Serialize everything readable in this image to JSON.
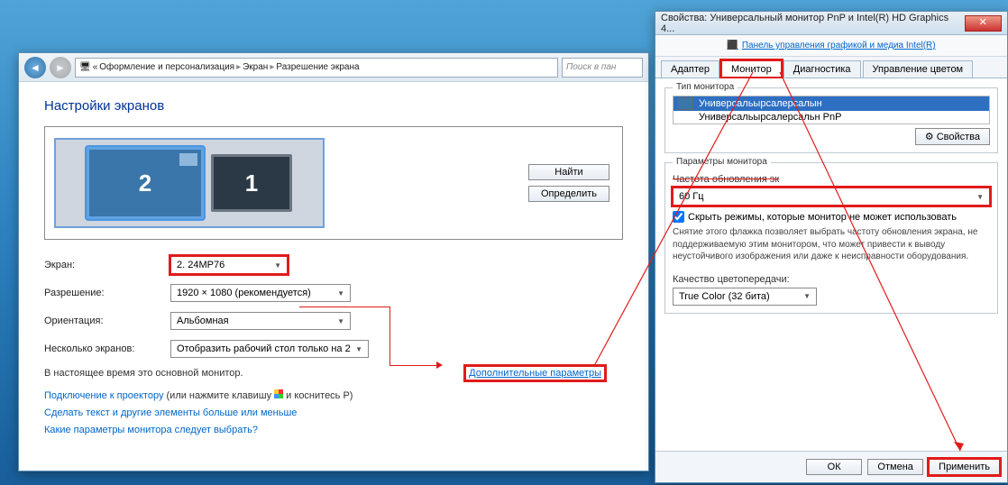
{
  "main": {
    "breadcrumb": {
      "p1": "Оформление и персонализация",
      "p2": "Экран",
      "p3": "Разрешение экрана"
    },
    "search_placeholder": "Поиск в пан",
    "title": "Настройки экранов",
    "find_btn": "Найти",
    "detect_btn": "Определить",
    "mon1_label": "1",
    "mon2_label": "2",
    "screen_label": "Экран:",
    "screen_value": "2. 24MP76",
    "resolution_label": "Разрешение:",
    "resolution_value": "1920 × 1080 (рекомендуется)",
    "orientation_label": "Ориентация:",
    "orientation_value": "Альбомная",
    "multi_label": "Несколько экранов:",
    "multi_value": "Отобразить рабочий стол только на 2",
    "primary_note": "В настоящее время это основной монитор.",
    "adv_link": "Дополнительные параметры",
    "link1_a": "Подключение к проектору",
    "link1_b": " (или нажмите клавишу ",
    "link1_c": " и коснитесь P)",
    "link2": "Сделать текст и другие элементы больше или меньше",
    "link3": "Какие параметры монитора следует выбрать?"
  },
  "props": {
    "title": "Свойства: Универсальный монитор PnP и Intel(R) HD Graphics 4...",
    "panel_link": "Панель управления графикой и медиа Intel(R)",
    "tabs": {
      "adapter": "Адаптер",
      "monitor": "Монитор",
      "diag": "Диагностика",
      "color": "Управление цветом"
    },
    "type_group": "Тип монитора",
    "list_sel": "Универсальырсалерсалын",
    "list_sel2": "Универсальырсалерсальн PnP",
    "props_btn": "Свойства",
    "params_group": "Параметры монитора",
    "refresh_label": "Частота обновления эк",
    "refresh_value": "60 Гц",
    "hide_checkbox": "Скрыть режимы, которые монитор не может использовать",
    "hide_note": "Снятие этого флажка позволяет выбрать частоту обновления экрана, не поддерживаемую этим монитором, что может привести к выводу неустойчивого изображения или даже к неисправности оборудования.",
    "color_quality_label": "Качество цветопередачи:",
    "color_quality_value": "True Color (32 бита)",
    "ok": "ОК",
    "cancel": "Отмена",
    "apply": "Применить"
  }
}
